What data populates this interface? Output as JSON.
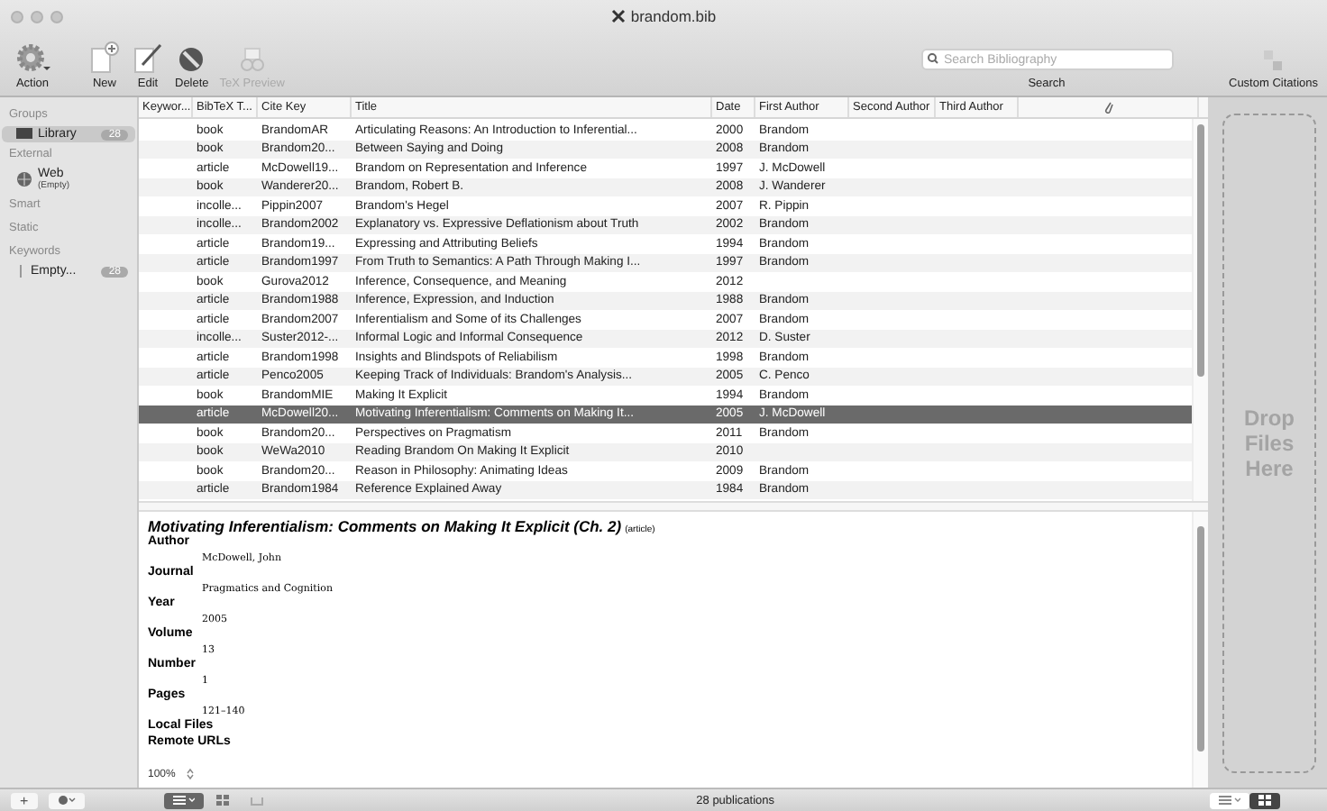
{
  "window": {
    "title": "brandom.bib"
  },
  "toolbar": [
    {
      "label": "Action",
      "kind": "gear",
      "disabled": false
    },
    {
      "label": "New",
      "kind": "new",
      "disabled": false
    },
    {
      "label": "Edit",
      "kind": "edit",
      "disabled": false
    },
    {
      "label": "Delete",
      "kind": "delete",
      "disabled": false
    },
    {
      "label": "TeX Preview",
      "kind": "tex",
      "disabled": true
    }
  ],
  "search": {
    "placeholder": "Search Bibliography",
    "label": "Search"
  },
  "custom_citations": {
    "label": "Custom Citations"
  },
  "sidebar": {
    "sections": [
      {
        "title": "Groups",
        "items": [
          {
            "label": "Library",
            "count": "28",
            "kind": "library",
            "selected": true
          }
        ]
      },
      {
        "title": "External",
        "items": [
          {
            "label": "Web",
            "sub": "(Empty)",
            "kind": "web",
            "selected": false
          }
        ]
      },
      {
        "title": "Smart"
      },
      {
        "title": "Static"
      },
      {
        "title": "Keywords",
        "items": [
          {
            "label": "Empty...",
            "count": "28",
            "kind": "keyword",
            "selected": false
          }
        ]
      }
    ]
  },
  "table": {
    "columns": [
      "Keywor...",
      "BibTeX T...",
      "Cite Key",
      "Title",
      "Date",
      "First Author",
      "Second Author",
      "Third Author"
    ],
    "rows": [
      {
        "type": "book",
        "cite_key": "BrandomAR",
        "title": "Articulating Reasons: An Introduction to Inferential...",
        "date": "2000",
        "first_author": "Brandom",
        "selected": false
      },
      {
        "type": "book",
        "cite_key": "Brandom20...",
        "title": "Between Saying and Doing",
        "date": "2008",
        "first_author": "Brandom",
        "selected": false
      },
      {
        "type": "article",
        "cite_key": "McDowell19...",
        "title": "Brandom on Representation and Inference",
        "date": "1997",
        "first_author": "J. McDowell",
        "selected": false
      },
      {
        "type": "book",
        "cite_key": "Wanderer20...",
        "title": "Brandom, Robert B.",
        "date": "2008",
        "first_author": "J. Wanderer",
        "selected": false
      },
      {
        "type": "incolle...",
        "cite_key": "Pippin2007",
        "title": "Brandom's Hegel",
        "date": "2007",
        "first_author": "R. Pippin",
        "selected": false
      },
      {
        "type": "incolle...",
        "cite_key": "Brandom2002",
        "title": "Explanatory vs. Expressive Deflationism about Truth",
        "date": "2002",
        "first_author": "Brandom",
        "selected": false
      },
      {
        "type": "article",
        "cite_key": "Brandom19...",
        "title": "Expressing and Attributing Beliefs",
        "date": "1994",
        "first_author": "Brandom",
        "selected": false
      },
      {
        "type": "article",
        "cite_key": "Brandom1997",
        "title": "From Truth to Semantics: A Path Through Making I...",
        "date": "1997",
        "first_author": "Brandom",
        "selected": false
      },
      {
        "type": "book",
        "cite_key": "Gurova2012",
        "title": "Inference, Consequence, and Meaning",
        "date": "2012",
        "first_author": "",
        "selected": false
      },
      {
        "type": "article",
        "cite_key": "Brandom1988",
        "title": "Inference, Expression, and Induction",
        "date": "1988",
        "first_author": "Brandom",
        "selected": false
      },
      {
        "type": "article",
        "cite_key": "Brandom2007",
        "title": "Inferentialism and Some of its Challenges",
        "date": "2007",
        "first_author": "Brandom",
        "selected": false
      },
      {
        "type": "incolle...",
        "cite_key": "Suster2012-...",
        "title": "Informal Logic and Informal Consequence",
        "date": "2012",
        "first_author": "D. Suster",
        "selected": false
      },
      {
        "type": "article",
        "cite_key": "Brandom1998",
        "title": "Insights and Blindspots of Reliabilism",
        "date": "1998",
        "first_author": "Brandom",
        "selected": false
      },
      {
        "type": "article",
        "cite_key": "Penco2005",
        "title": "Keeping Track of Individuals: Brandom's Analysis...",
        "date": "2005",
        "first_author": "C. Penco",
        "selected": false
      },
      {
        "type": "book",
        "cite_key": "BrandomMIE",
        "title": "Making It Explicit",
        "date": "1994",
        "first_author": "Brandom",
        "selected": false
      },
      {
        "type": "article",
        "cite_key": "McDowell20...",
        "title": "Motivating Inferentialism: Comments on Making It...",
        "date": "2005",
        "first_author": "J. McDowell",
        "selected": true
      },
      {
        "type": "book",
        "cite_key": "Brandom20...",
        "title": "Perspectives on Pragmatism",
        "date": "2011",
        "first_author": "Brandom",
        "selected": false
      },
      {
        "type": "book",
        "cite_key": "WeWa2010",
        "title": "Reading Brandom On Making It Explicit",
        "date": "2010",
        "first_author": "",
        "selected": false
      },
      {
        "type": "book",
        "cite_key": "Brandom20...",
        "title": "Reason in Philosophy: Animating Ideas",
        "date": "2009",
        "first_author": "Brandom",
        "selected": false
      },
      {
        "type": "article",
        "cite_key": "Brandom1984",
        "title": "Reference Explained Away",
        "date": "1984",
        "first_author": "Brandom",
        "selected": false
      }
    ]
  },
  "preview": {
    "title": "Motivating Inferentialism: Comments on Making It Explicit (Ch. 2)",
    "entry_type": "(article)",
    "fields": [
      {
        "name": "Author",
        "value": "McDowell, John"
      },
      {
        "name": "Journal",
        "value": "Pragmatics and Cognition"
      },
      {
        "name": "Year",
        "value": "2005"
      },
      {
        "name": "Volume",
        "value": "13"
      },
      {
        "name": "Number",
        "value": "1"
      },
      {
        "name": "Pages",
        "value": "121–140"
      },
      {
        "name": "Local Files"
      },
      {
        "name": "Remote URLs"
      }
    ],
    "zoom": "100%"
  },
  "drop_zone": {
    "label": "Drop Files Here"
  },
  "status_bar": {
    "add": "+",
    "count": "28 publications"
  }
}
